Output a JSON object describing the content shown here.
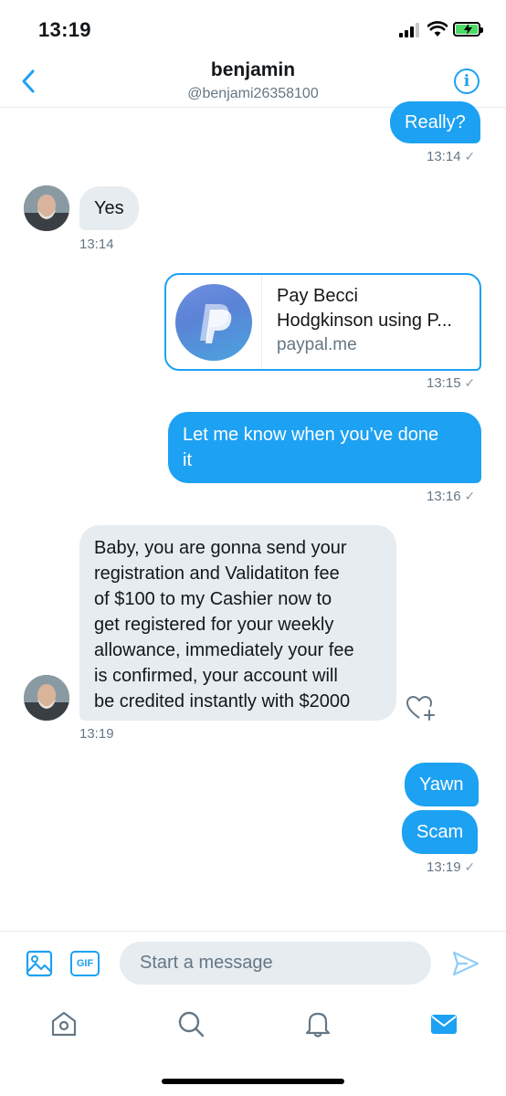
{
  "status_bar": {
    "time": "13:19"
  },
  "header": {
    "name": "benjamin",
    "handle": "@benjami26358100"
  },
  "messages": [
    {
      "direction": "out",
      "type": "text",
      "text": "Really?",
      "time": "13:14"
    },
    {
      "direction": "in",
      "type": "text",
      "text": "Yes",
      "time": "13:14"
    },
    {
      "direction": "out",
      "type": "link_card",
      "title_line1": "Pay Becci",
      "title_line2": "Hodgkinson using P...",
      "domain": "paypal.me",
      "time": "13:15"
    },
    {
      "direction": "out",
      "type": "text",
      "lines": [
        "Let me know when you’ve done",
        "it"
      ],
      "time": "13:16"
    },
    {
      "direction": "in",
      "type": "text",
      "lines": [
        "Baby, you are gonna send your",
        "registration and Validatiton fee",
        "of $100 to my Cashier now to",
        "get registered for your weekly",
        "allowance, immediately your fee",
        "is confirmed, your account will",
        "be credited instantly with $2000"
      ],
      "time": "13:19"
    },
    {
      "direction": "out",
      "type": "text",
      "text": "Yawn"
    },
    {
      "direction": "out",
      "type": "text",
      "text": "Scam",
      "time": "13:19"
    }
  ],
  "composer": {
    "gif_label": "GIF",
    "placeholder": "Start a message"
  },
  "tabbar": [
    "home-icon",
    "search-icon",
    "notifications-icon",
    "messages-icon"
  ],
  "colors": {
    "accent": "#1da1f2",
    "incoming_bubble": "#e6ecf0",
    "secondary_text": "#657786",
    "battery": "#4cd964"
  }
}
